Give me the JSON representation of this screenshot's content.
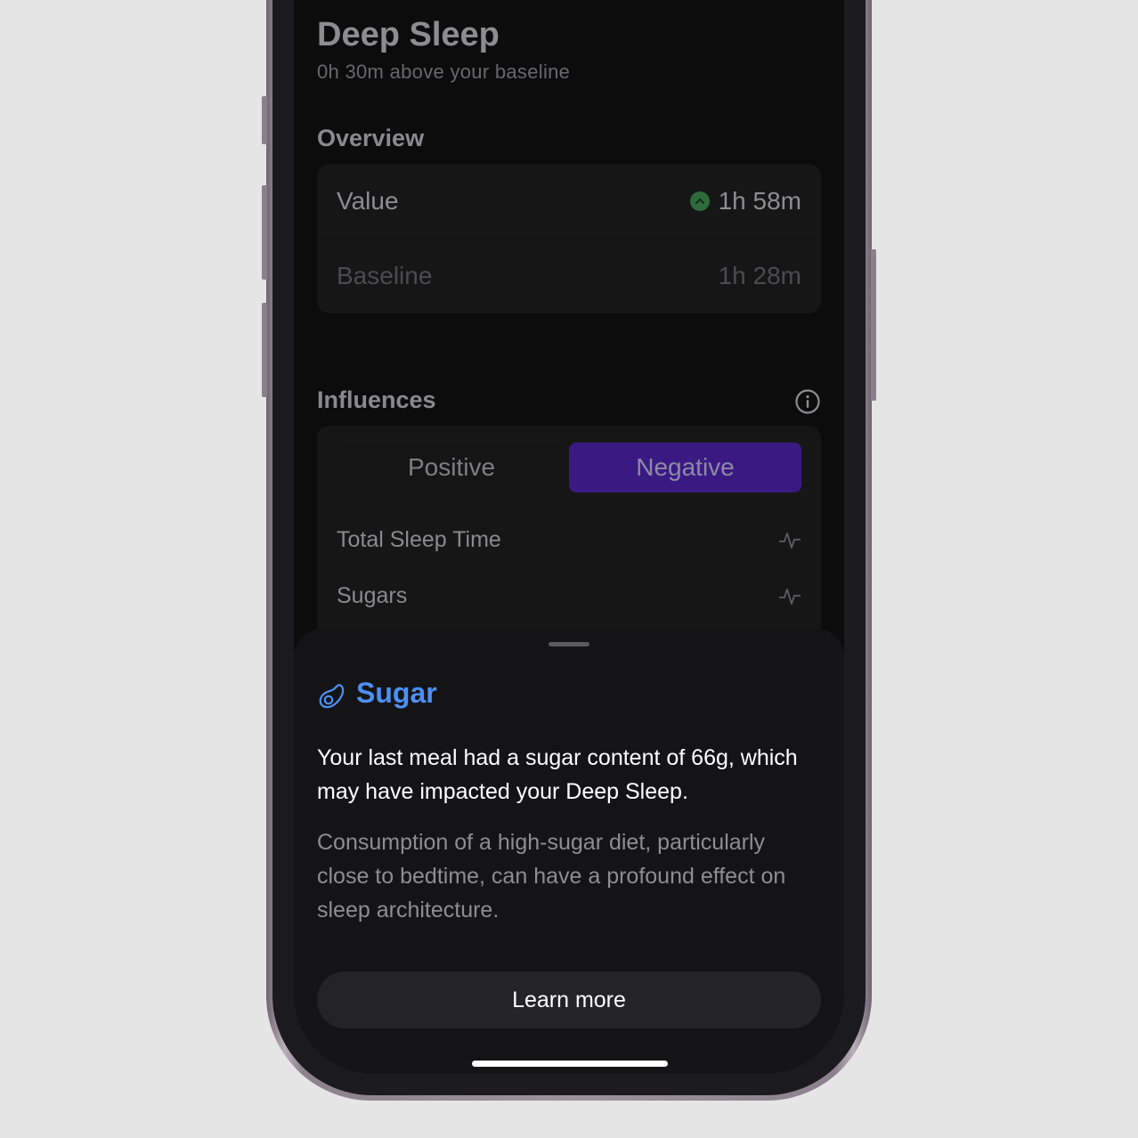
{
  "header": {
    "title": "Deep Sleep",
    "subtitle": "0h 30m above your baseline"
  },
  "overview": {
    "heading": "Overview",
    "value_label": "Value",
    "value": "1h 58m",
    "value_trend_icon": "chevron-up-icon",
    "baseline_label": "Baseline",
    "baseline": "1h 28m"
  },
  "influences": {
    "heading": "Influences",
    "info_icon": "info-icon",
    "tabs": [
      {
        "label": "Positive",
        "selected": false
      },
      {
        "label": "Negative",
        "selected": true
      }
    ],
    "items": [
      {
        "label": "Total Sleep Time",
        "icon": "pulse-icon"
      },
      {
        "label": "Sugars",
        "icon": "pulse-icon"
      }
    ]
  },
  "sheet": {
    "title": "Sugar",
    "icon": "avocado-icon",
    "primary_text": "Your last meal had a sugar content of 66g, which may have impacted your Deep Sleep.",
    "secondary_text": "Consumption of a high-sugar diet, particularly close to bedtime, can have a profound effect on sleep architecture.",
    "button_label": "Learn more"
  },
  "colors": {
    "accent_blue": "#4d8ff5",
    "negative_tab": "#3a1a82",
    "trend_green": "#2f6b3b"
  }
}
